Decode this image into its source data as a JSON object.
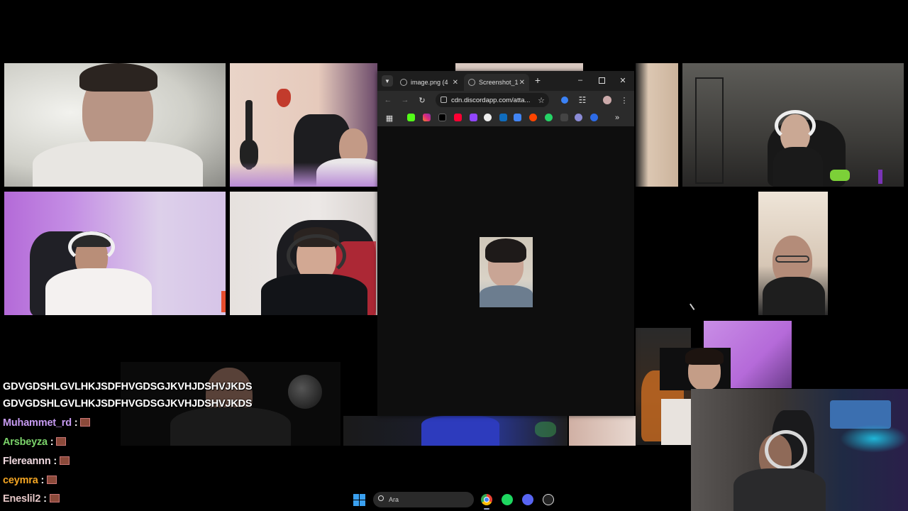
{
  "browser": {
    "tabs": [
      {
        "title": "image.png (4",
        "active": false
      },
      {
        "title": "Screenshot_1",
        "active": true
      }
    ],
    "url": "cdn.discordapp.com/atta..."
  },
  "chat": [
    {
      "user": "",
      "message": "GDVGDSHLGVLHKJSDFHVGDSGJKVHJDSHVJKDS",
      "color": "#ffffff"
    },
    {
      "user": "",
      "message": "GDVGDSHLGVLHKJSDFHVGDSGJKVHJDSHVJKDS",
      "color": "#ffffff"
    },
    {
      "user": "Muhammet_rd",
      "message": ":",
      "color": "#c79bf2"
    },
    {
      "user": "Arsbeyza",
      "message": ":",
      "color": "#7bd36a"
    },
    {
      "user": "Flereannn",
      "message": ":",
      "color": "#f0d9e0"
    },
    {
      "user": "ceymra",
      "message": ":",
      "color": "#f5a623"
    },
    {
      "user": "Eneslil2",
      "message": ":",
      "color": "#e5c7c7"
    }
  ],
  "taskbar": {
    "search_placeholder": "Ara",
    "apps": [
      "windows-start-icon",
      "chrome-icon",
      "spotify-icon",
      "discord-icon",
      "obs-icon"
    ]
  },
  "colors": {
    "accent_active_speaker": "#7fd18a",
    "purple_light": "#b87ee8"
  }
}
